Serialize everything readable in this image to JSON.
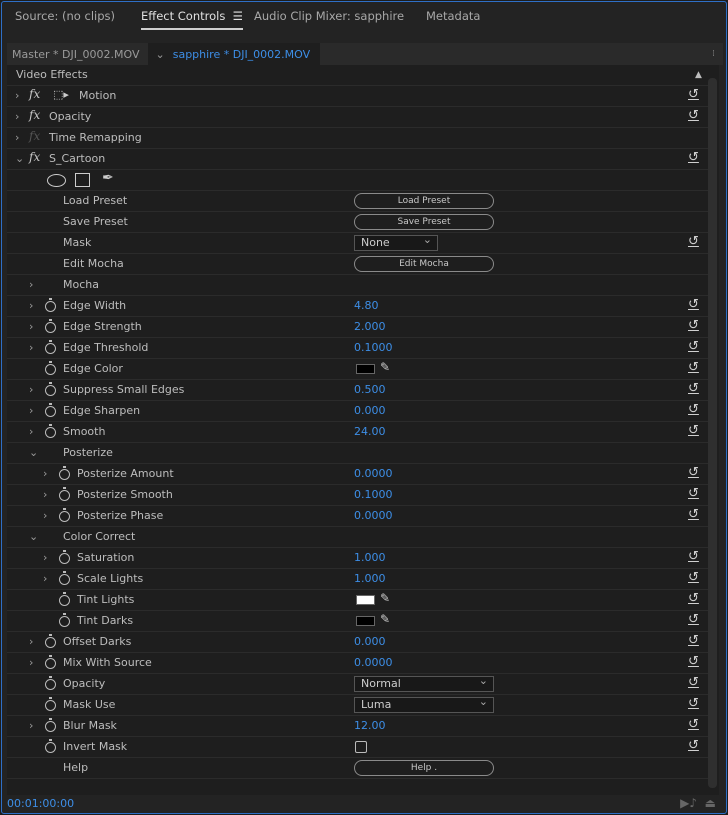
{
  "tabs": [
    {
      "label": "Source: (no clips)"
    },
    {
      "label": "Effect Controls",
      "menu": "☰"
    },
    {
      "label": "Audio Clip Mixer: sapphire"
    },
    {
      "label": "Metadata"
    }
  ],
  "clip": {
    "master": "Master * DJI_0002.MOV",
    "sequence": "sapphire * DJI_0002.MOV"
  },
  "section": "Video Effects",
  "accent": "#3d8ee6",
  "rows": [
    {
      "label": "Motion",
      "level": 0,
      "chev": "closed",
      "fx": true,
      "motion_icon": true,
      "reset": true
    },
    {
      "label": "Opacity",
      "level": 0,
      "chev": "closed",
      "fx": true,
      "reset": true
    },
    {
      "label": "Time Remapping",
      "level": 0,
      "chev": "closed",
      "fx": "dim"
    },
    {
      "label": "S_Cartoon",
      "level": 0,
      "chev": "open",
      "fx": true,
      "reset": true
    },
    {
      "type": "mask-tools",
      "icons": [
        "ellipse-mask-icon",
        "rectangle-mask-icon",
        "pen-mask-icon"
      ]
    },
    {
      "label": "Load Preset",
      "level": 1,
      "type": "button",
      "value": "Load Preset"
    },
    {
      "label": "Save Preset",
      "level": 1,
      "type": "button",
      "value": "Save Preset"
    },
    {
      "label": "Mask",
      "level": 1,
      "type": "select",
      "value": "None",
      "reset": true,
      "w": 84
    },
    {
      "label": "Edit Mocha",
      "level": 1,
      "type": "button",
      "value": "Edit Mocha"
    },
    {
      "label": "Mocha",
      "level": 1,
      "chev": "closed"
    },
    {
      "label": "Edge Width",
      "level": 1,
      "chev": "closed",
      "sw": true,
      "value": "4.80",
      "reset": true
    },
    {
      "label": "Edge Strength",
      "level": 1,
      "chev": "closed",
      "sw": true,
      "value": "2.000",
      "reset": true
    },
    {
      "label": "Edge Threshold",
      "level": 1,
      "chev": "closed",
      "sw": true,
      "value": "0.1000",
      "reset": true
    },
    {
      "label": "Edge Color",
      "level": 1,
      "sw": true,
      "type": "color",
      "value": "#000000",
      "reset": true
    },
    {
      "label": "Suppress Small Edges",
      "level": 1,
      "chev": "closed",
      "sw": true,
      "value": "0.500",
      "reset": true
    },
    {
      "label": "Edge Sharpen",
      "level": 1,
      "chev": "closed",
      "sw": true,
      "value": "0.000",
      "reset": true
    },
    {
      "label": "Smooth",
      "level": 1,
      "chev": "closed",
      "sw": true,
      "value": "24.00",
      "reset": true
    },
    {
      "label": "Posterize",
      "level": 1,
      "chev": "open"
    },
    {
      "label": "Posterize Amount",
      "level": 2,
      "chev": "closed",
      "sw": true,
      "value": "0.0000",
      "reset": true
    },
    {
      "label": "Posterize Smooth",
      "level": 2,
      "chev": "closed",
      "sw": true,
      "value": "0.1000",
      "reset": true
    },
    {
      "label": "Posterize Phase",
      "level": 2,
      "chev": "closed",
      "sw": true,
      "value": "0.0000",
      "reset": true
    },
    {
      "label": "Color Correct",
      "level": 1,
      "chev": "open"
    },
    {
      "label": "Saturation",
      "level": 2,
      "chev": "closed",
      "sw": true,
      "value": "1.000",
      "reset": true
    },
    {
      "label": "Scale Lights",
      "level": 2,
      "chev": "closed",
      "sw": true,
      "value": "1.000",
      "reset": true
    },
    {
      "label": "Tint Lights",
      "level": 2,
      "sw": true,
      "type": "color",
      "value": "#ffffff",
      "reset": true
    },
    {
      "label": "Tint Darks",
      "level": 2,
      "sw": true,
      "type": "color",
      "value": "#000000",
      "reset": true
    },
    {
      "label": "Offset Darks",
      "level": 1,
      "chev": "closed",
      "sw": true,
      "value": "0.000",
      "reset": true
    },
    {
      "label": "Mix With Source",
      "level": 1,
      "chev": "closed",
      "sw": true,
      "value": "0.0000",
      "reset": true
    },
    {
      "label": "Opacity",
      "level": 1,
      "sw": true,
      "type": "select",
      "value": "Normal",
      "reset": true,
      "w": 140
    },
    {
      "label": "Mask Use",
      "level": 1,
      "sw": true,
      "type": "select",
      "value": "Luma",
      "reset": true,
      "w": 140
    },
    {
      "label": "Blur Mask",
      "level": 1,
      "chev": "closed",
      "sw": true,
      "value": "12.00",
      "reset": true
    },
    {
      "label": "Invert Mask",
      "level": 1,
      "sw": true,
      "type": "checkbox",
      "value": false,
      "reset": true
    },
    {
      "label": "Help",
      "level": 1,
      "type": "button",
      "value": "Help  ."
    }
  ],
  "timecode": "00:01:00:00"
}
